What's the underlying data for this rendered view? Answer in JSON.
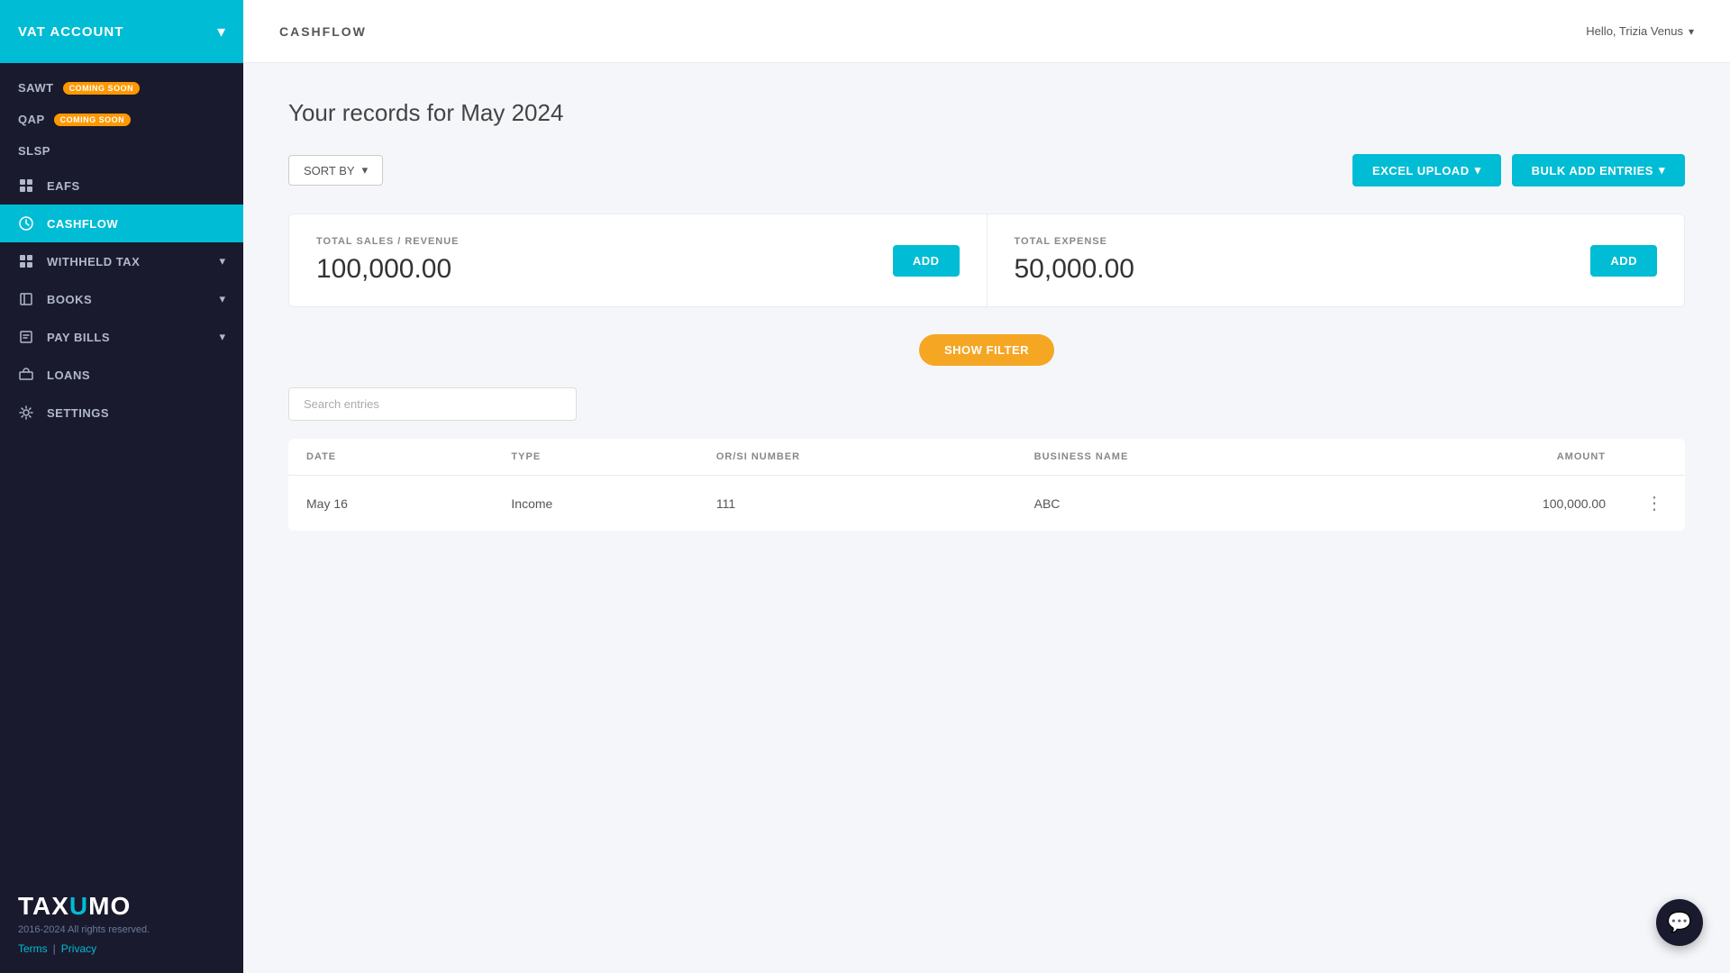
{
  "sidebar": {
    "header": {
      "title": "VAT ACCOUNT",
      "arrow": "▾"
    },
    "items": [
      {
        "id": "sawt",
        "label": "SAWT",
        "badge": "COMING SOON",
        "hasBadge": true,
        "icon": "document-icon",
        "active": false,
        "hasArrow": false
      },
      {
        "id": "qap",
        "label": "QAP",
        "badge": "COMING SOON",
        "hasBadge": true,
        "icon": "document-icon",
        "active": false,
        "hasArrow": false
      },
      {
        "id": "slsp",
        "label": "SLSP",
        "badge": "",
        "hasBadge": false,
        "icon": "document-icon",
        "active": false,
        "hasArrow": false
      },
      {
        "id": "eafs",
        "label": "EAFS",
        "badge": "",
        "hasBadge": false,
        "icon": "grid-icon",
        "active": false,
        "hasArrow": false
      },
      {
        "id": "cashflow",
        "label": "CASHFLOW",
        "badge": "",
        "hasBadge": false,
        "icon": "chart-icon",
        "active": true,
        "hasArrow": false
      },
      {
        "id": "withheld-tax",
        "label": "WITHHELD TAX",
        "badge": "",
        "hasBadge": false,
        "icon": "grid-icon",
        "active": false,
        "hasArrow": true
      },
      {
        "id": "books",
        "label": "BOOKS",
        "badge": "",
        "hasBadge": false,
        "icon": "book-icon",
        "active": false,
        "hasArrow": true
      },
      {
        "id": "pay-bills",
        "label": "PAY BILLS",
        "badge": "",
        "hasBadge": false,
        "icon": "bill-icon",
        "active": false,
        "hasArrow": true
      },
      {
        "id": "loans",
        "label": "LOANS",
        "badge": "",
        "hasBadge": false,
        "icon": "loans-icon",
        "active": false,
        "hasArrow": false
      },
      {
        "id": "settings",
        "label": "SETTINGS",
        "badge": "",
        "hasBadge": false,
        "icon": "gear-icon",
        "active": false,
        "hasArrow": false
      }
    ],
    "footer": {
      "logo_prefix": "TAX",
      "logo_highlight": "U",
      "logo_suffix": "MO",
      "copyright": "2016-2024 All rights reserved.",
      "terms_label": "Terms",
      "separator": "|",
      "privacy_label": "Privacy"
    }
  },
  "topbar": {
    "title": "CASHFLOW",
    "user_greeting": "Hello, Trizia Venus",
    "user_arrow": "▾"
  },
  "main": {
    "page_title": "Your records for May 2024",
    "toolbar": {
      "sort_by_label": "SORT BY",
      "sort_arrow": "▾",
      "excel_upload_label": "EXCEL UPLOAD",
      "excel_upload_arrow": "▾",
      "bulk_add_label": "BULK ADD ENTRIES",
      "bulk_add_arrow": "▾"
    },
    "stats": {
      "total_sales_label": "TOTAL SALES / REVENUE",
      "total_sales_value": "100,000.00",
      "total_sales_add_label": "ADD",
      "total_expense_label": "TOTAL EXPENSE",
      "total_expense_value": "50,000.00",
      "total_expense_add_label": "ADD"
    },
    "show_filter_label": "SHOW FILTER",
    "search": {
      "placeholder": "Search entries"
    },
    "table": {
      "columns": [
        "DATE",
        "TYPE",
        "OR/SI NUMBER",
        "BUSINESS NAME",
        "AMOUNT",
        ""
      ],
      "rows": [
        {
          "date": "May 16",
          "type": "Income",
          "or_si_number": "111",
          "business_name": "ABC",
          "amount": "100,000.00"
        }
      ]
    }
  },
  "chat": {
    "icon": "💬"
  }
}
